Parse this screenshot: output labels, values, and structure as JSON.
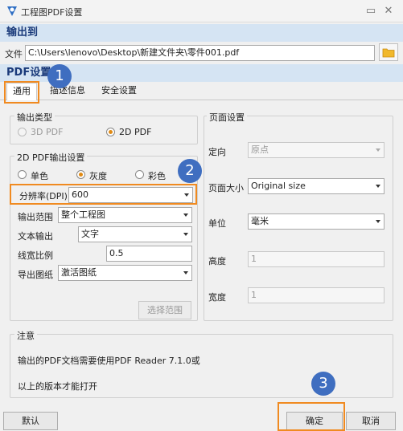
{
  "window": {
    "title": "工程图PDF设置"
  },
  "output_to": {
    "header": "输出到",
    "file_label": "文件",
    "file_path": "C:\\Users\\lenovo\\Desktop\\新建文件夹\\零件001.pdf"
  },
  "pdf_settings": {
    "header": "PDF设置"
  },
  "tabs": [
    "通用",
    "描述信息",
    "安全设置"
  ],
  "output_type": {
    "legend": "输出类型",
    "options": [
      "3D PDF",
      "2D PDF"
    ],
    "selected": "2D PDF"
  },
  "pdf2d": {
    "legend": "2D PDF输出设置",
    "color_modes": [
      "单色",
      "灰度",
      "彩色"
    ],
    "selected_color_mode": "灰度",
    "resolution_label": "分辨率(DPI)",
    "resolution_value": "600",
    "range_label": "输出范围",
    "range_value": "整个工程图",
    "text_label": "文本输出",
    "text_value": "文字",
    "linewidth_label": "线宽比例",
    "linewidth_value": "0.5",
    "export_label": "导出图纸",
    "export_value": "激活图纸",
    "select_range_button": "选择范围"
  },
  "page": {
    "legend": "页面设置",
    "orientation_label": "定向",
    "orientation_value": "原点",
    "size_label": "页面大小",
    "size_value": "Original size",
    "unit_label": "单位",
    "unit_value": "毫米",
    "height_label": "高度",
    "height_value": "1",
    "width_label": "宽度",
    "width_value": "1"
  },
  "note": {
    "legend": "注意",
    "line1": "输出的PDF文档需要使用PDF Reader 7.1.0或",
    "line2": "以上的版本才能打开"
  },
  "footer": {
    "default": "默认",
    "ok": "确定",
    "cancel": "取消"
  },
  "annotations": [
    "1",
    "2",
    "3"
  ],
  "colors": {
    "header_bg": "#d5e4f3",
    "accent": "#f08a20",
    "badge": "#3f6ec0",
    "radio_dot": "#e08a14"
  },
  "icons": {
    "app": "app-icon",
    "folder": "folder-icon",
    "help": "help-icon",
    "close": "close-icon"
  }
}
